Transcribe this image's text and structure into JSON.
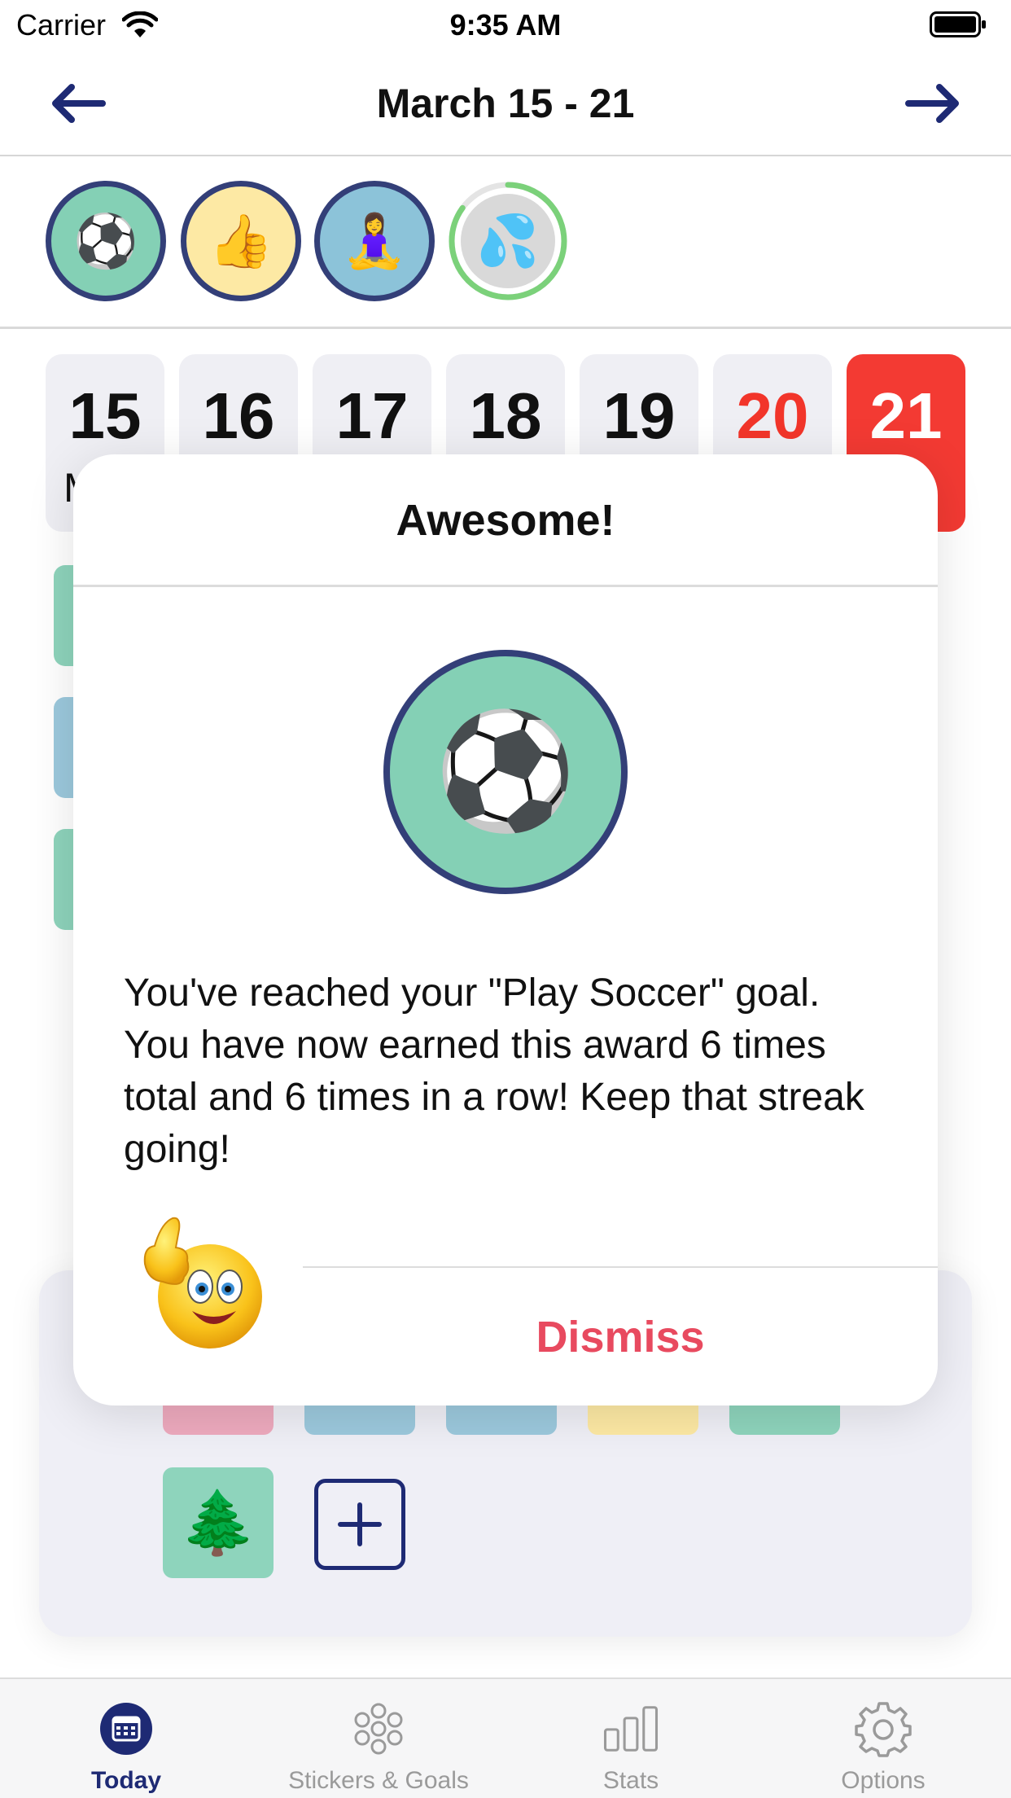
{
  "status_bar": {
    "carrier": "Carrier",
    "time": "9:35 AM"
  },
  "header": {
    "title": "March 15 - 21",
    "prev_icon": "arrow-left-icon",
    "next_icon": "arrow-right-icon",
    "accent_color": "#1e2a74"
  },
  "badges": [
    {
      "icon": "soccer-ball",
      "glyph": "⚽",
      "color": "#84d0b5"
    },
    {
      "icon": "thumbs-up",
      "glyph": "👍",
      "color": "#fde9a4"
    },
    {
      "icon": "person-meditating",
      "glyph": "🧘‍♀️",
      "color": "#8cc3d9"
    },
    {
      "icon": "sweat-droplets",
      "glyph": "💦",
      "color": "#d9d9d9",
      "progress": 0.85
    }
  ],
  "days": [
    {
      "num": "15",
      "abbr": "M"
    },
    {
      "num": "16"
    },
    {
      "num": "17"
    },
    {
      "num": "18"
    },
    {
      "num": "19"
    },
    {
      "num": "20"
    },
    {
      "num": "21"
    }
  ],
  "stickers": {
    "tree_glyph": "🌲",
    "add_icon": "plus-icon"
  },
  "tabs": [
    {
      "label": "Today",
      "icon": "calendar-icon",
      "active": true
    },
    {
      "label": "Stickers & Goals",
      "icon": "stickers-icon",
      "active": false
    },
    {
      "label": "Stats",
      "icon": "bar-chart-icon",
      "active": false
    },
    {
      "label": "Options",
      "icon": "gear-icon",
      "active": false
    }
  ],
  "modal": {
    "title": "Awesome!",
    "award_glyph": "⚽",
    "message": "You've reached your \"Play Soccer\" goal. You have now earned this award 6 times total and 6 times in a row! Keep that streak going!",
    "dismiss_label": "Dismiss",
    "dismiss_color": "#e84a5f",
    "mascot_icon": "thumbs-up-smiley-icon"
  }
}
